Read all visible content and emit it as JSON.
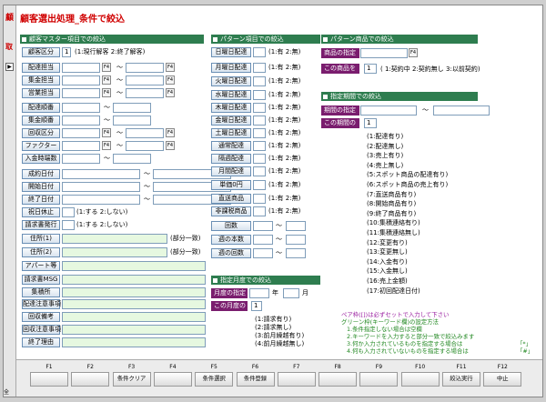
{
  "window": {
    "title": "顧客選出処理_条件で絞込",
    "left_chars": [
      "顧",
      "取"
    ],
    "row_marker": "▶",
    "bottom_label": "全"
  },
  "colors": {
    "section_header": "#2e7d4f",
    "title_red": "#d00000",
    "purple_label": "#7a1d6e",
    "green_input": "#e6f8e0"
  },
  "sections": {
    "customer": "顧客マスター項目での絞込",
    "pattern": "パターン項目での絞込",
    "product": "パターン商品での絞込",
    "period": "指定期間での絞込",
    "month": "指定月度での絞込"
  },
  "customer": {
    "rows": [
      {
        "label": "顧客区分",
        "value": "1",
        "note": "(1:現行解客 2:終了解客)"
      },
      {
        "label": "配達担当",
        "f4": "F4",
        "sep": "～"
      },
      {
        "label": "集金担当",
        "f4": "F4",
        "sep": "～"
      },
      {
        "label": "営業担当",
        "f4": "F4",
        "sep": "～"
      },
      {
        "label": "配達順番",
        "sep": "～"
      },
      {
        "label": "集金順番",
        "sep": "～"
      },
      {
        "label": "回収区分",
        "f4": "F4",
        "sep": "～"
      },
      {
        "label": "ファクター",
        "f4": "F4",
        "sep": "～"
      },
      {
        "label": "入金時端数",
        "sep": "～"
      },
      {
        "label": "成約日付",
        "sep": "～"
      },
      {
        "label": "開始日付",
        "sep": "～"
      },
      {
        "label": "終了日付",
        "sep": "～"
      },
      {
        "label": "祝日休止",
        "note": "(1:する 2:しない)"
      },
      {
        "label": "請求書発行",
        "note": "(1:する 2:しない)"
      },
      {
        "label": "住所(1)",
        "note": "(部分一致)"
      },
      {
        "label": "住所(2)",
        "note": "(部分一致)"
      },
      {
        "label": "アパート等"
      },
      {
        "label": "請求書MSG"
      },
      {
        "label": "集積所"
      },
      {
        "label": "配達注意事項"
      },
      {
        "label": "回収備考"
      },
      {
        "label": "回収注意事項"
      },
      {
        "label": "終了理由"
      }
    ]
  },
  "pattern": {
    "rows": [
      {
        "label": "日曜日配達",
        "note": "(1:有 2:無)"
      },
      {
        "label": "月曜日配達",
        "note": "(1:有 2:無)"
      },
      {
        "label": "火曜日配達",
        "note": "(1:有 2:無)"
      },
      {
        "label": "水曜日配達",
        "note": "(1:有 2:無)"
      },
      {
        "label": "木曜日配達",
        "note": "(1:有 2:無)"
      },
      {
        "label": "金曜日配達",
        "note": "(1:有 2:無)"
      },
      {
        "label": "土曜日配達",
        "note": "(1:有 2:無)"
      },
      {
        "label": "通常配達",
        "note": "(1:有 2:無)"
      },
      {
        "label": "隔週配達",
        "note": "(1:有 2:無)"
      },
      {
        "label": "月間配達",
        "note": "(1:有 2:無)"
      },
      {
        "label": "単価0円",
        "note": "(1:有 2:無)"
      },
      {
        "label": "直送商品",
        "note": "(1:有 2:無)"
      },
      {
        "label": "非課税商品",
        "note": "(1:有 2:無)"
      },
      {
        "label": "回数",
        "sep": "～"
      },
      {
        "label": "週の本数",
        "sep": "～"
      },
      {
        "label": "週の回数",
        "sep": "～"
      }
    ]
  },
  "product": {
    "label1": "商品の指定",
    "f4": "F4",
    "label2": "この商品を",
    "value2": "1",
    "note2": "( 1:契約中 2:契約無し 3:以前契約)"
  },
  "period": {
    "label1": "期間の指定",
    "sep": "～",
    "label2": "この期間の",
    "value2": "1",
    "options": [
      "(1:配達有り)",
      "(2:配達無し)",
      "(3:売上有り)",
      "(4:売上無し)",
      "(5:スポット商品の配達有り)",
      "(6:スポット商品の売上有り)",
      "(7:直送商品有り)",
      "(8:開始商品有り)",
      "(9:終了商品有り)",
      "(10:集積連絡有り)",
      "(11:集積連絡無し)",
      "(12:変更有り)",
      "(13:変更無し)",
      "(14:入金有り)",
      "(15:入金無し)",
      "(16:売上金額)",
      "(17:初回配達日付)"
    ]
  },
  "month": {
    "label1": "月度の指定",
    "year": "年",
    "monthlbl": "月",
    "label2": "この月度の",
    "value2": "1",
    "options": [
      "(1:請求有り)",
      "(2:請求無し)",
      "(3:前月繰越有り)",
      "(4:前月繰越無し)"
    ]
  },
  "notes": {
    "pair": "ペア枠([])は必ずセットで入力して下さい",
    "green_title": "グリーン枠(キーワード欄)の設定方法",
    "lines": [
      "1.条件指定しない場合は空欄",
      "2.キーワードを入力すると部分一致で絞込みます",
      "3.何か入力されているものを指定する場合は",
      "4.何も入力されていないものを指定する場合は"
    ],
    "mark3": "「*」",
    "mark4": "「#」"
  },
  "fkeys": [
    {
      "n": "F1",
      "label": ""
    },
    {
      "n": "F2",
      "label": ""
    },
    {
      "n": "F3",
      "label": "条件クリア"
    },
    {
      "n": "F4",
      "label": ""
    },
    {
      "n": "F5",
      "label": "条件選択"
    },
    {
      "n": "F6",
      "label": "条件登録"
    },
    {
      "n": "F7",
      "label": ""
    },
    {
      "n": "F8",
      "label": ""
    },
    {
      "n": "F9",
      "label": ""
    },
    {
      "n": "F10",
      "label": ""
    },
    {
      "n": "F11",
      "label": "絞込実行"
    },
    {
      "n": "F12",
      "label": "中止"
    }
  ]
}
